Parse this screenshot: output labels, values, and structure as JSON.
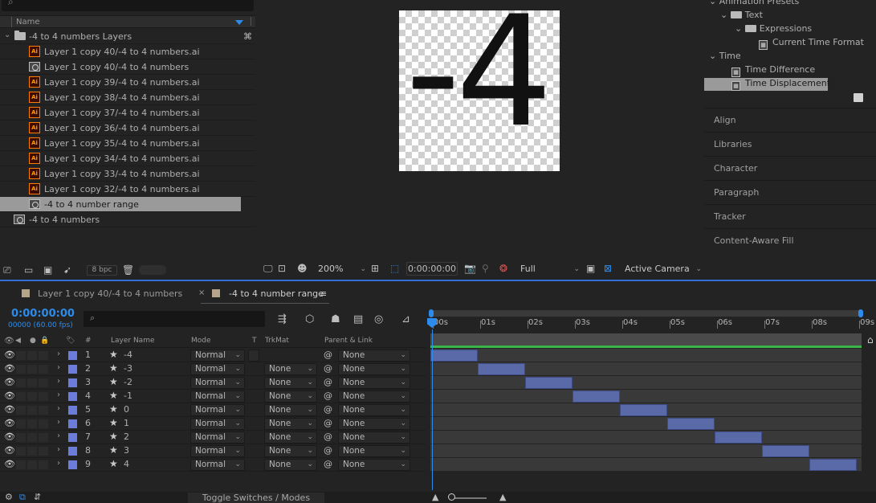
{
  "project": {
    "column_name": "Name",
    "folder": "-4 to 4 numbers Layers",
    "items": [
      {
        "label": "Layer 1 copy 40/-4 to 4 numbers.ai",
        "type": "ai"
      },
      {
        "label": "Layer 1 copy 40/-4 to 4 numbers",
        "type": "comp"
      },
      {
        "label": "Layer 1 copy 39/-4 to 4 numbers.ai",
        "type": "ai"
      },
      {
        "label": "Layer 1 copy 38/-4 to 4 numbers.ai",
        "type": "ai"
      },
      {
        "label": "Layer 1 copy 37/-4 to 4 numbers.ai",
        "type": "ai"
      },
      {
        "label": "Layer 1 copy 36/-4 to 4 numbers.ai",
        "type": "ai"
      },
      {
        "label": "Layer 1 copy 35/-4 to 4 numbers.ai",
        "type": "ai"
      },
      {
        "label": "Layer 1 copy 34/-4 to 4 numbers.ai",
        "type": "ai"
      },
      {
        "label": "Layer 1 copy 33/-4 to 4 numbers.ai",
        "type": "ai"
      },
      {
        "label": "Layer 1 copy 32/-4 to 4 numbers.ai",
        "type": "ai"
      },
      {
        "label": "-4 to 4 number range",
        "type": "comp",
        "selected": true
      }
    ],
    "root_comp": "-4 to 4 numbers",
    "bpc": "8 bpc"
  },
  "viewer": {
    "display_value": "-4",
    "zoom": "200%",
    "timecode": "0:00:00:00",
    "resolution": "Full",
    "camera": "Active Camera"
  },
  "effects": {
    "animation_presets": "Animation Presets",
    "text": "Text",
    "expressions": "Expressions",
    "current_time_format": "Current Time Format",
    "time": "Time",
    "time_difference": "Time Difference",
    "time_displacement": "Time Displacement"
  },
  "panels": [
    "Align",
    "Libraries",
    "Character",
    "Paragraph",
    "Tracker",
    "Content-Aware Fill"
  ],
  "timeline": {
    "tabs": [
      "Layer 1 copy 40/-4 to 4 numbers",
      "-4 to 4 number range"
    ],
    "current_time": "0:00:00:00",
    "frame_info": "00000 (60.00 fps)",
    "search_placeholder": "",
    "columns": {
      "hash": "#",
      "layer_name": "Layer Name",
      "mode": "Mode",
      "t": "T",
      "trkmat": "TrkMat",
      "parent": "Parent & Link"
    },
    "ruler": [
      "00s",
      "01s",
      "02s",
      "03s",
      "04s",
      "05s",
      "06s",
      "07s",
      "08s",
      "09s"
    ],
    "layers": [
      {
        "index": "1",
        "name": "-4",
        "mode": "Normal",
        "trkmat": "",
        "parent": "None"
      },
      {
        "index": "2",
        "name": "-3",
        "mode": "Normal",
        "trkmat": "None",
        "parent": "None"
      },
      {
        "index": "3",
        "name": "-2",
        "mode": "Normal",
        "trkmat": "None",
        "parent": "None"
      },
      {
        "index": "4",
        "name": "-1",
        "mode": "Normal",
        "trkmat": "None",
        "parent": "None"
      },
      {
        "index": "5",
        "name": "0",
        "mode": "Normal",
        "trkmat": "None",
        "parent": "None"
      },
      {
        "index": "6",
        "name": "1",
        "mode": "Normal",
        "trkmat": "None",
        "parent": "None"
      },
      {
        "index": "7",
        "name": "2",
        "mode": "Normal",
        "trkmat": "None",
        "parent": "None"
      },
      {
        "index": "8",
        "name": "3",
        "mode": "Normal",
        "trkmat": "None",
        "parent": "None"
      },
      {
        "index": "9",
        "name": "4",
        "mode": "Normal",
        "trkmat": "None",
        "parent": "None"
      }
    ],
    "layer_spans_seconds": [
      [
        0,
        1
      ],
      [
        1,
        2
      ],
      [
        2,
        3
      ],
      [
        3,
        4
      ],
      [
        4,
        5
      ],
      [
        5,
        6
      ],
      [
        6,
        7
      ],
      [
        7,
        8
      ],
      [
        8,
        9
      ]
    ],
    "duration_seconds": 9.1,
    "toggle_label": "Toggle Switches / Modes",
    "label_color": "#6b7cdb",
    "accent_color": "#2d8ceb"
  }
}
